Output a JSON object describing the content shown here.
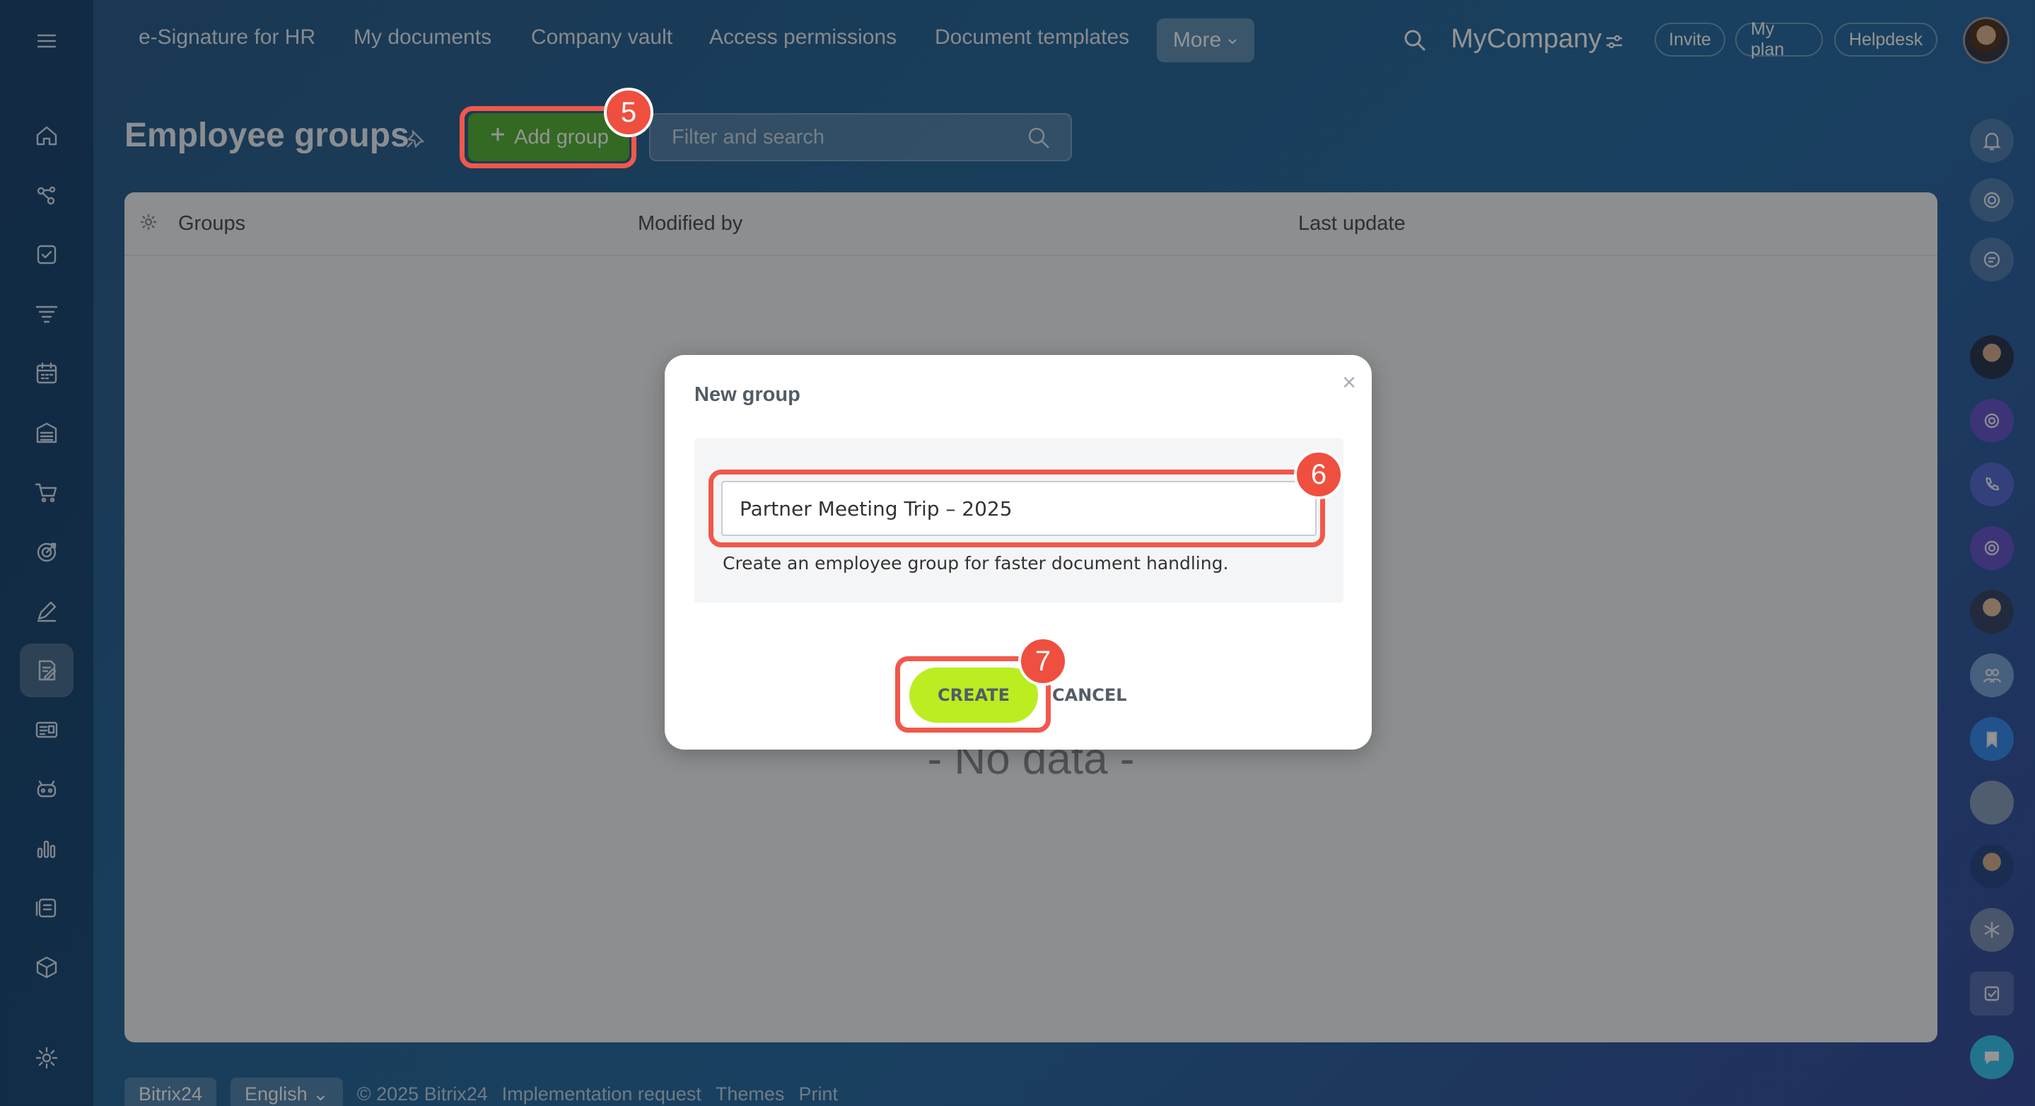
{
  "top_nav": {
    "items": [
      "e-Signature for HR",
      "My documents",
      "Company vault",
      "Access permissions",
      "Document templates"
    ],
    "more_label": "More",
    "company": "MyCompany",
    "pills": [
      "Invite",
      "My plan",
      "Helpdesk"
    ]
  },
  "header": {
    "title": "Employee groups",
    "add_group_label": "Add group",
    "search_placeholder": "Filter and search"
  },
  "table": {
    "columns": [
      "Groups",
      "Modified by",
      "Last update"
    ],
    "empty_text": "- No data -"
  },
  "footer": {
    "brand": "Bitrix24",
    "language": "English",
    "links": [
      "© 2025 Bitrix24",
      "Implementation request",
      "Themes",
      "Print"
    ]
  },
  "modal": {
    "title": "New group",
    "close_symbol": "×",
    "input_value": "Partner Meeting Trip – 2025",
    "hint": "Create an employee group for faster document handling.",
    "create_label": "CREATE",
    "cancel_label": "CANCEL"
  },
  "steps": {
    "add_group": "5",
    "name_input": "6",
    "create": "7"
  },
  "colors": {
    "accent_red": "#f1584b",
    "create_green": "#bbed21",
    "add_green": "#58b63c"
  },
  "left_sidebar_icons": [
    "hamburger-icon",
    "home-icon",
    "crm-icon",
    "tasks-icon",
    "filter-icon",
    "calendar-icon",
    "store-icon",
    "cart-icon",
    "target-icon",
    "pen-icon",
    "sign-doc-icon",
    "id-card-icon",
    "robot-icon",
    "chart-icon",
    "stack-icon",
    "box-icon",
    "settings-icon"
  ],
  "right_sidebar_icons": [
    "bell-icon",
    "copilot-icon",
    "chat-search-icon",
    "user-avatar",
    "copilot-icon",
    "phone-icon",
    "copilot-icon",
    "user-avatar",
    "group-icon",
    "bookmark-icon",
    "cat-avatar",
    "user-avatar",
    "snowflake-icon",
    "checkbox-icon",
    "chat-icon"
  ]
}
